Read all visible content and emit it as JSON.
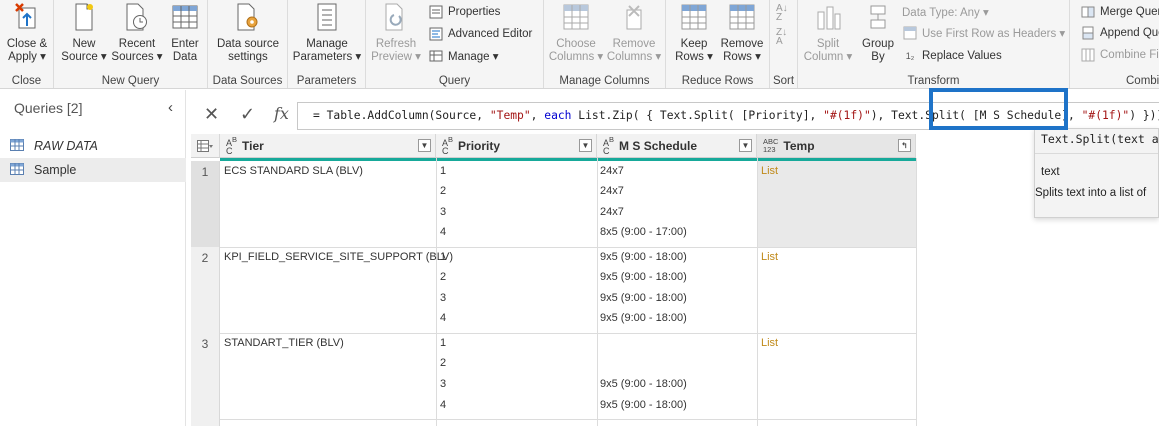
{
  "ribbon": {
    "close": {
      "apply": "Close &\nApply ▾",
      "group": "Close"
    },
    "new_query": {
      "new_source": "New\nSource ▾",
      "recent_sources": "Recent\nSources ▾",
      "enter_data": "Enter\nData",
      "group": "New Query"
    },
    "data_sources": {
      "settings": "Data source\nsettings",
      "group": "Data Sources"
    },
    "parameters": {
      "manage": "Manage\nParameters ▾",
      "group": "Parameters"
    },
    "query": {
      "refresh": "Refresh\nPreview ▾",
      "properties": "Properties",
      "advanced_editor": "Advanced Editor",
      "manage": "Manage ▾",
      "group": "Query"
    },
    "manage_columns": {
      "choose": "Choose\nColumns ▾",
      "remove": "Remove\nColumns ▾",
      "group": "Manage Columns"
    },
    "reduce_rows": {
      "keep": "Keep\nRows ▾",
      "remove": "Remove\nRows ▾",
      "group": "Reduce Rows"
    },
    "sort": {
      "group": "Sort"
    },
    "transform": {
      "split_column": "Split\nColumn ▾",
      "group_by": "Group\nBy",
      "data_type": "Data Type: Any ▾",
      "first_row_headers": "Use First Row as Headers ▾",
      "replace_values": "Replace Values",
      "group": "Transform"
    },
    "combine": {
      "merge": "Merge Queri",
      "append": "Append Que",
      "combine_files": "Combine Fil",
      "group": "Combine"
    }
  },
  "queries": {
    "header": "Queries [2]",
    "items": [
      {
        "label": "RAW DATA"
      },
      {
        "label": "Sample"
      }
    ]
  },
  "formula": {
    "p1": "= Table.AddColumn(Source, ",
    "s1": "\"Temp\"",
    "p2": ", ",
    "k1": "each",
    "p3": " List.Zip( { Text.Split( [Priority], ",
    "s2": "\"#(1f)\"",
    "p4": "), Text.Split( [M S Schedule], ",
    "s3": "\"#(1f)\"",
    "p5": ") }))"
  },
  "tooltip": {
    "signature": "Text.Split(text as",
    "param": "text",
    "description": "Splits text into a list of"
  },
  "grid": {
    "headers": [
      "Tier",
      "Priority",
      "M S Schedule",
      "Temp"
    ],
    "rows": [
      {
        "num": "1",
        "tier": "ECS STANDARD SLA (BLV)",
        "priorities": [
          "1",
          "2",
          "3",
          "4"
        ],
        "schedules": [
          "24x7",
          "24x7",
          "24x7",
          "8x5 (9:00 - 17:00)"
        ],
        "temp": "List"
      },
      {
        "num": "2",
        "tier": "KPI_FIELD_SERVICE_SITE_SUPPORT (BLV)",
        "priorities": [
          "1",
          "2",
          "3",
          "4"
        ],
        "schedules": [
          "9x5 (9:00 - 18:00)",
          "9x5 (9:00 - 18:00)",
          "9x5 (9:00 - 18:00)",
          "9x5 (9:00 - 18:00)"
        ],
        "temp": "List"
      },
      {
        "num": "3",
        "tier": "STANDART_TIER (BLV)",
        "priorities": [
          "1",
          "2",
          "3",
          "4"
        ],
        "schedules": [
          "",
          "",
          "9x5 (9:00 - 18:00)",
          "9x5 (9:00 - 18:00)"
        ],
        "temp": "List"
      }
    ]
  },
  "colors": {
    "accent_teal": "#17a99a",
    "highlight_blue": "#1e73c8",
    "list_link": "#c08a1a"
  }
}
